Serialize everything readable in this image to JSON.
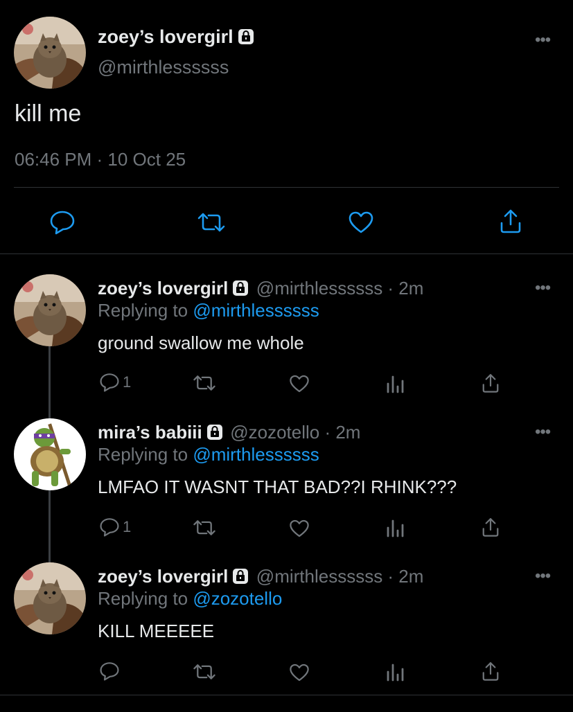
{
  "main_tweet": {
    "display_name": "zoey’s lovergirl",
    "handle": "@mirthlessssss",
    "text": "kill me",
    "timestamp": "06:46 PM · 10 Oct 25",
    "more": "•••"
  },
  "replies": [
    {
      "display_name": "zoey’s lovergirl",
      "handle_time": "@mirthlessssss · 2m",
      "replying_prefix": "Replying to ",
      "replying_to": "@mirthlessssss",
      "text": "ground swallow me whole",
      "reply_count": "1",
      "more": "•••"
    },
    {
      "display_name": "mira’s babiii",
      "handle_time": "@zozotello · 2m",
      "replying_prefix": "Replying to ",
      "replying_to": "@mirthlessssss",
      "text": "LMFAO IT WASNT THAT BAD??I RHINK???",
      "reply_count": "1",
      "more": "•••"
    },
    {
      "display_name": "zoey’s lovergirl",
      "handle_time": "@mirthlessssss · 2m",
      "replying_prefix": "Replying to ",
      "replying_to": "@zozotello",
      "text": "KILL MEEEEE",
      "reply_count": "",
      "more": "•••"
    }
  ],
  "icons": {
    "reply": "reply-icon",
    "retweet": "retweet-icon",
    "like": "like-icon",
    "share": "share-icon",
    "views": "views-icon",
    "lock": "lock-icon"
  },
  "colors": {
    "background": "#000000",
    "text": "#e7e9ea",
    "muted": "#71767b",
    "link": "#1d9bf0"
  }
}
